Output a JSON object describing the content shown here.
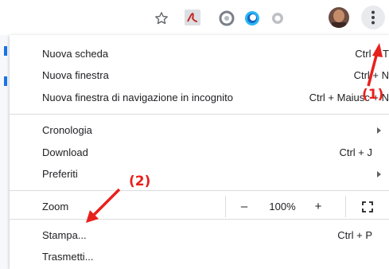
{
  "toolbar": {
    "icons": [
      "star-icon",
      "pdf-extension-icon",
      "extension-icon",
      "extension-icon",
      "extension-icon",
      "avatar",
      "three-dots-menu-icon"
    ]
  },
  "menu": {
    "groups": [
      [
        {
          "label": "Nuova scheda",
          "shortcut": "Ctrl + T"
        },
        {
          "label": "Nuova finestra",
          "shortcut": "Ctrl + N"
        },
        {
          "label": "Nuova finestra di navigazione in incognito",
          "shortcut": "Ctrl + Maiusc + N"
        }
      ],
      [
        {
          "label": "Cronologia",
          "submenu": true
        },
        {
          "label": "Download",
          "shortcut": "Ctrl + J"
        },
        {
          "label": "Preferiti",
          "submenu": true
        }
      ]
    ],
    "zoom": {
      "label": "Zoom",
      "minus": "–",
      "value": "100%",
      "plus": "+"
    },
    "bottom_items": [
      {
        "label": "Stampa...",
        "shortcut": "Ctrl + P"
      },
      {
        "label": "Trasmetti..."
      }
    ]
  },
  "annotations": {
    "step1": "(1)",
    "step2": "(2)",
    "color": "#e8211d"
  }
}
